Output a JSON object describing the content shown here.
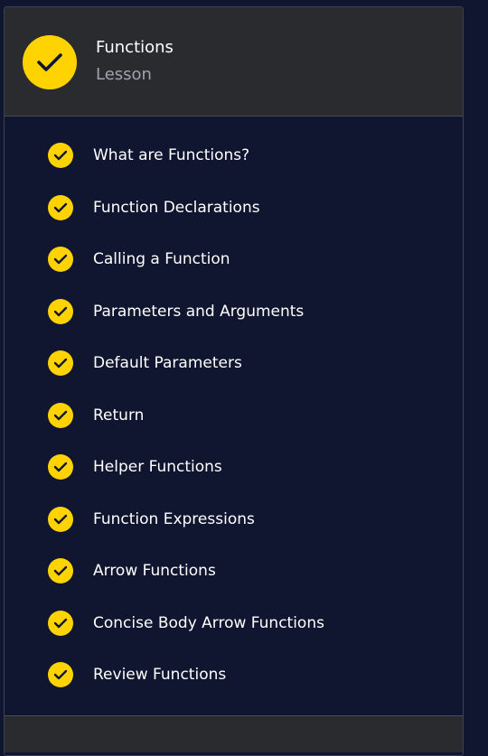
{
  "lesson": {
    "title": "Functions",
    "subtitle": "Lesson",
    "status_icon": "check-icon",
    "accent_color": "#ffd300"
  },
  "items": [
    {
      "label": "What are Functions?",
      "completed": true
    },
    {
      "label": "Function Declarations",
      "completed": true
    },
    {
      "label": "Calling a Function",
      "completed": true
    },
    {
      "label": "Parameters and Arguments",
      "completed": true
    },
    {
      "label": "Default Parameters",
      "completed": true
    },
    {
      "label": "Return",
      "completed": true
    },
    {
      "label": "Helper Functions",
      "completed": true
    },
    {
      "label": "Function Expressions",
      "completed": true
    },
    {
      "label": "Arrow Functions",
      "completed": true
    },
    {
      "label": "Concise Body Arrow Functions",
      "completed": true
    },
    {
      "label": "Review Functions",
      "completed": true
    }
  ]
}
